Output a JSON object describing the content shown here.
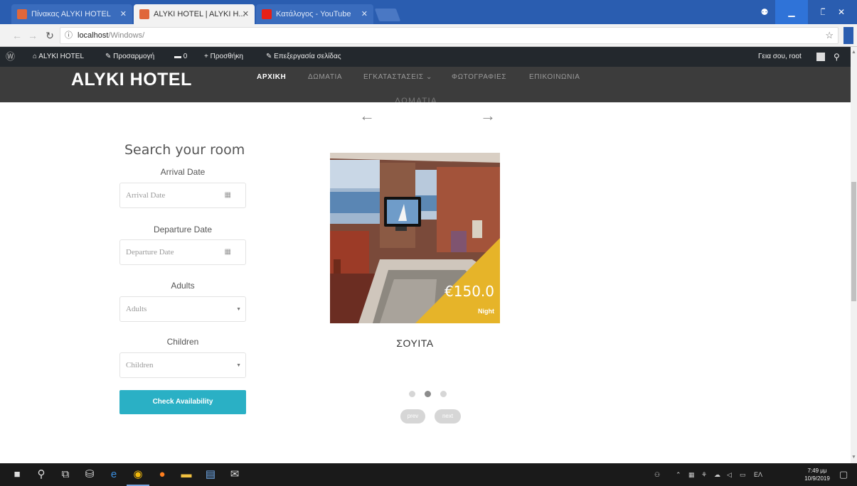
{
  "browser": {
    "tabs": [
      {
        "label": "Πίνακας ΑLYKI HOTEL",
        "active": false,
        "favicon_color": "#e0673a"
      },
      {
        "label": "ALYKI HOTEL | ALYKI H...",
        "active": true,
        "favicon_color": "#e0673a"
      },
      {
        "label": "Κατάλογος - YouTube",
        "active": false,
        "favicon_color": "#e62117"
      }
    ],
    "url_host": "localhost",
    "url_path": "/Windows/",
    "window_controls": {
      "profile": "⚉",
      "minimize": "▁",
      "maximize": "❐",
      "close": "✕"
    }
  },
  "wp_admin_bar": {
    "site_name": "ALYKI HOTEL",
    "customize": "Προσαρμογή",
    "comments_count": "0",
    "new_label": "Προσθήκη",
    "edit_page": "Επεξεργασία σελίδας",
    "account": "Γεια σου, root"
  },
  "site": {
    "logo": "ALYKI HOTEL",
    "nav": [
      "ΑΡΧΙΚΗ",
      "ΔΩΜΑΤΙΑ",
      "ΕΓΚΑΤΑΣΤΑΣΕΙΣ ⌄",
      "ΦΩΤΟΓΡΑΦΙΕΣ",
      "ΕΠΙΚΟΙΝΩΝΙΑ"
    ],
    "active_nav": "ΑΡΧΙΚΗ"
  },
  "rooms": {
    "section_title_partial": "ΔΩΜΑΤΙΑ",
    "prev_arrow": "←",
    "next_arrow": "→",
    "card": {
      "name": "ΣΟΥΙΤΑ",
      "price": "€150.0",
      "per": "Night",
      "accent_color": "#e6b429"
    },
    "dots_total": 3,
    "dots_active_index": 1,
    "pager_prev": "prev",
    "pager_next": "next"
  },
  "search": {
    "title": "Search your room",
    "arrival_label": "Arrival Date",
    "arrival_placeholder": "Arrival Date",
    "departure_label": "Departure Date",
    "departure_placeholder": "Departure Date",
    "adults_label": "Adults",
    "adults_value": "Adults",
    "children_label": "Children",
    "children_value": "Children",
    "button": "Check Availability",
    "button_color": "#2ab0c5"
  },
  "taskbar": {
    "icons": [
      "windows-icon",
      "search-icon",
      "task-view-icon",
      "store-icon",
      "edge-icon",
      "chrome-icon",
      "firefox-icon",
      "file-explorer-icon",
      "notepad-icon",
      "mail-icon"
    ],
    "tray_text": "ΕΛ",
    "time": "7:49 μμ",
    "date": "10/9/2019"
  }
}
